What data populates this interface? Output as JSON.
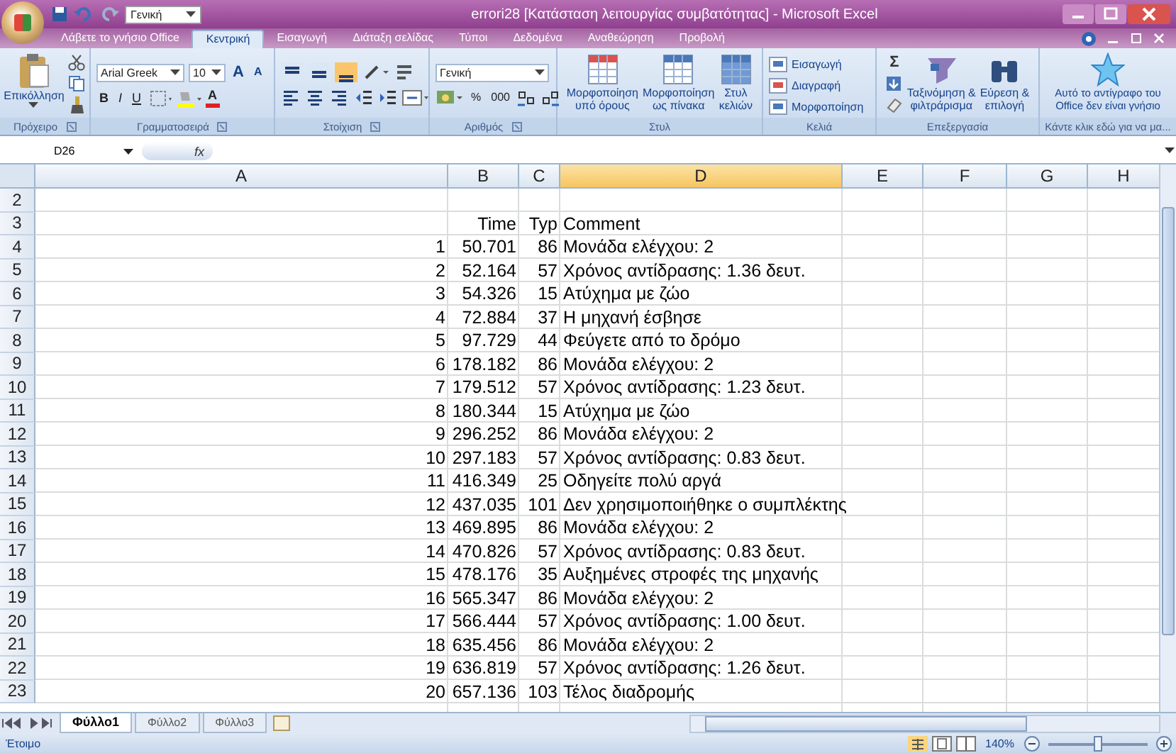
{
  "window": {
    "title": "errori28  [Κατάσταση λειτουργίας συμβατότητας] - Microsoft Excel"
  },
  "quick_access": {
    "font": "Γενική"
  },
  "tabs": [
    {
      "label": "Λάβετε το γνήσιο Office",
      "selected": false
    },
    {
      "label": "Κεντρική",
      "selected": true
    },
    {
      "label": "Εισαγωγή",
      "selected": false
    },
    {
      "label": "Διάταξη σελίδας",
      "selected": false
    },
    {
      "label": "Τύποι",
      "selected": false
    },
    {
      "label": "Δεδομένα",
      "selected": false
    },
    {
      "label": "Αναθεώρηση",
      "selected": false
    },
    {
      "label": "Προβολή",
      "selected": false
    }
  ],
  "ribbon": {
    "groups": [
      {
        "label": "Πρόχειρο",
        "large": [
          {
            "lines": [
              "Επικόλληση"
            ]
          }
        ]
      },
      {
        "label": "Γραμματοσειρά",
        "font": "Arial Greek",
        "size": "10",
        "size_buttons": [
          "A",
          "A"
        ],
        "style_buttons": [
          "B",
          "I",
          "U"
        ],
        "color_button": "A"
      },
      {
        "label": "Στοίχιση",
        "align_buttons": [
          {
            "selected": false
          },
          {
            "selected": false
          },
          {
            "selected": true
          }
        ]
      },
      {
        "label": "Αριθμός",
        "format": "Γενική",
        "buttons": [
          "%",
          "000"
        ]
      },
      {
        "label": "Στυλ",
        "large": [
          {
            "lines": [
              "Μορφοποίηση",
              "υπό όρους"
            ]
          },
          {
            "lines": [
              "Μορφοποίηση",
              "ως πίνακα"
            ]
          },
          {
            "lines": [
              "Στυλ",
              "κελιών"
            ]
          }
        ]
      },
      {
        "label": "Κελιά",
        "small": [
          "Εισαγωγή",
          "Διαγραφή",
          "Μορφοποίηση"
        ]
      },
      {
        "label": "Επεξεργασία",
        "sum": "Σ",
        "large": [
          {
            "lines": [
              "Ταξινόμηση &",
              "φιλτράρισμα"
            ]
          },
          {
            "lines": [
              "Εύρεση &",
              "επιλογή"
            ]
          }
        ]
      },
      {
        "label": "Κάντε κλικ εδώ για να μα...",
        "large": [
          {
            "lines": [
              "Αυτό το αντίγραφο του",
              "Office δεν είναι γνήσιο"
            ]
          }
        ]
      }
    ]
  },
  "formula_bar": {
    "name_box": "D26",
    "function_label": "fx"
  },
  "columns": [
    {
      "label": "A",
      "selected": false
    },
    {
      "label": "B",
      "selected": false
    },
    {
      "label": "C",
      "selected": false
    },
    {
      "label": "D",
      "selected": true
    },
    {
      "label": "E",
      "selected": false
    },
    {
      "label": "F",
      "selected": false
    },
    {
      "label": "G",
      "selected": false
    },
    {
      "label": "H",
      "selected": false
    }
  ],
  "rows": [
    {
      "number": "2"
    },
    {
      "number": "3",
      "b": "Time",
      "c": "Typ",
      "d": "Comment"
    },
    {
      "number": "4",
      "a": "1",
      "b": "50.701",
      "c": "86",
      "d": "Μονάδα ελέγχου: 2"
    },
    {
      "number": "5",
      "a": "2",
      "b": "52.164",
      "c": "57",
      "d": "Χρόνος αντίδρασης: 1.36 δευτ."
    },
    {
      "number": "6",
      "a": "3",
      "b": "54.326",
      "c": "15",
      "d": "Ατύχημα με ζώο"
    },
    {
      "number": "7",
      "a": "4",
      "b": "72.884",
      "c": "37",
      "d": "Η μηχανή έσβησε"
    },
    {
      "number": "8",
      "a": "5",
      "b": "97.729",
      "c": "44",
      "d": "Φεύγετε από το δρόμο"
    },
    {
      "number": "9",
      "a": "6",
      "b": "178.182",
      "c": "86",
      "d": "Μονάδα ελέγχου: 2"
    },
    {
      "number": "10",
      "a": "7",
      "b": "179.512",
      "c": "57",
      "d": "Χρόνος αντίδρασης: 1.23 δευτ."
    },
    {
      "number": "11",
      "a": "8",
      "b": "180.344",
      "c": "15",
      "d": "Ατύχημα με ζώο"
    },
    {
      "number": "12",
      "a": "9",
      "b": "296.252",
      "c": "86",
      "d": "Μονάδα ελέγχου: 2"
    },
    {
      "number": "13",
      "a": "10",
      "b": "297.183",
      "c": "57",
      "d": "Χρόνος αντίδρασης: 0.83 δευτ."
    },
    {
      "number": "14",
      "a": "11",
      "b": "416.349",
      "c": "25",
      "d": "Οδηγείτε πολύ αργά"
    },
    {
      "number": "15",
      "a": "12",
      "b": "437.035",
      "c": "101",
      "d": "Δεν χρησιμοποιήθηκε ο συμπλέκτης"
    },
    {
      "number": "16",
      "a": "13",
      "b": "469.895",
      "c": "86",
      "d": "Μονάδα ελέγχου: 2"
    },
    {
      "number": "17",
      "a": "14",
      "b": "470.826",
      "c": "57",
      "d": "Χρόνος αντίδρασης: 0.83 δευτ."
    },
    {
      "number": "18",
      "a": "15",
      "b": "478.176",
      "c": "35",
      "d": "Αυξημένες στροφές της μηχανής"
    },
    {
      "number": "19",
      "a": "16",
      "b": "565.347",
      "c": "86",
      "d": "Μονάδα ελέγχου: 2"
    },
    {
      "number": "20",
      "a": "17",
      "b": "566.444",
      "c": "57",
      "d": "Χρόνος αντίδρασης: 1.00 δευτ."
    },
    {
      "number": "21",
      "a": "18",
      "b": "635.456",
      "c": "86",
      "d": "Μονάδα ελέγχου: 2"
    },
    {
      "number": "22",
      "a": "19",
      "b": "636.819",
      "c": "57",
      "d": "Χρόνος αντίδρασης: 1.26 δευτ."
    },
    {
      "number": "23",
      "a": "20",
      "b": "657.136",
      "c": "103",
      "d": "Τέλος διαδρομής"
    }
  ],
  "sheets": [
    {
      "label": "Φύλλο1",
      "selected": true
    },
    {
      "label": "Φύλλο2",
      "selected": false
    },
    {
      "label": "Φύλλο3",
      "selected": false
    }
  ],
  "status_bar": {
    "text": "Έτοιμο",
    "zoom": "140%",
    "zoom_slider": {
      "level": 0.5
    }
  }
}
